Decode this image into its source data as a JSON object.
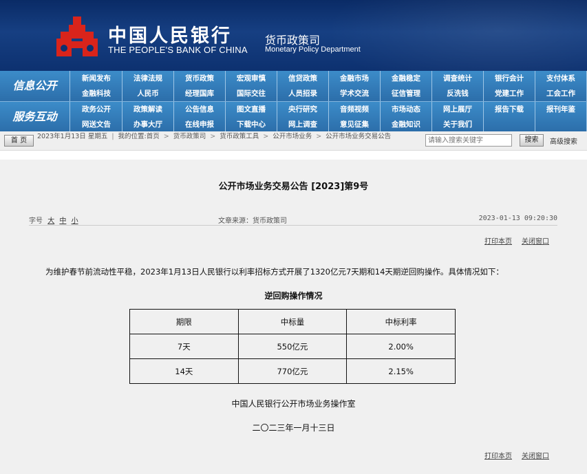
{
  "header": {
    "bank_name_cn": "中国人民银行",
    "bank_name_en": "THE PEOPLE'S BANK OF CHINA",
    "dept_cn": "货币政策司",
    "dept_en": "Monetary Policy Department",
    "logo_icon": "pboc-logo-icon",
    "logo_color": "#d9241b"
  },
  "nav": {
    "group1_label": "信息公开",
    "group1_items": [
      "新闻发布",
      "法律法规",
      "货币政策",
      "宏观审慎",
      "信贷政策",
      "金融市场",
      "金融稳定",
      "调查统计",
      "银行会计",
      "支付体系",
      "金融科技",
      "人民币",
      "经理国库",
      "国际交往",
      "人员招录",
      "学术交流",
      "征信管理",
      "反洗钱",
      "党建工作",
      "工会工作"
    ],
    "group2_label": "服务互动",
    "group2_items": [
      "政务公开",
      "政策解读",
      "公告信息",
      "图文直播",
      "央行研究",
      "音频视频",
      "市场动态",
      "网上展厅",
      "报告下载",
      "报刊年鉴",
      "网送文告",
      "办事大厅",
      "在线申报",
      "下载中心",
      "网上调查",
      "意见征集",
      "金融知识",
      "关于我们",
      "",
      ""
    ]
  },
  "infobar": {
    "home_label": "首 页",
    "date_line": "2023年1月13日  星期五",
    "location_label": "我的位置:首页",
    "crumbs": [
      "货币政策司",
      "货币政策工具",
      "公开市场业务",
      "公开市场业务交易公告"
    ],
    "search_placeholder": "请输入搜索关键字",
    "search_button": "搜索",
    "advanced_search": "高级搜索"
  },
  "article": {
    "title": "公开市场业务交易公告 [2023]第9号",
    "font_size_label": "字号",
    "font_sizes": [
      "大",
      "中",
      "小"
    ],
    "source": "文章来源：货币政策司",
    "datetime": "2023-01-13 09:20:30",
    "print_label": "打印本页",
    "close_label": "关闭窗口",
    "paragraph": "为维护春节前流动性平稳，2023年1月13日人民银行以利率招标方式开展了1320亿元7天期和14天期逆回购操作。具体情况如下：",
    "table_title": "逆回购操作情况",
    "table_headers": [
      "期限",
      "中标量",
      "中标利率"
    ],
    "table_rows": [
      [
        "7天",
        "550亿元",
        "2.00%"
      ],
      [
        "14天",
        "770亿元",
        "2.15%"
      ]
    ],
    "signer": "中国人民银行公开市场业务操作室",
    "sign_date": "二〇二三年一月十三日"
  }
}
